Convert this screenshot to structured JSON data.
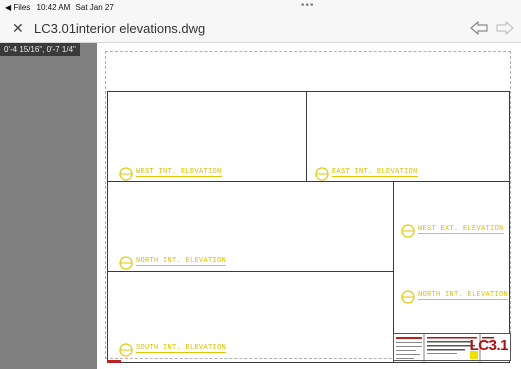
{
  "status_bar": {
    "back_app": "◀ Files",
    "time": "10:42 AM",
    "date": "Sat Jan 27",
    "dots": "•••"
  },
  "header": {
    "close_icon": "close-icon",
    "title": "LC3.01interior elevations.dwg",
    "undo_icon": "undo-arrow-icon",
    "redo_icon": "redo-arrow-icon"
  },
  "viewer": {
    "coordinates": "0'-4 15/16\", 0'-7 1/4\""
  },
  "drawing": {
    "label_color": "#e0c800",
    "labels": [
      "WEST INT. ELEVATION",
      "EAST INT. ELEVATION",
      "WEST EXT. ELEVATION",
      "NORTH INT. ELEVATION",
      "NORTH INT. ELEVATION",
      "SOUTH INT. ELEVATION"
    ],
    "sheet_number": "LC3.1"
  }
}
